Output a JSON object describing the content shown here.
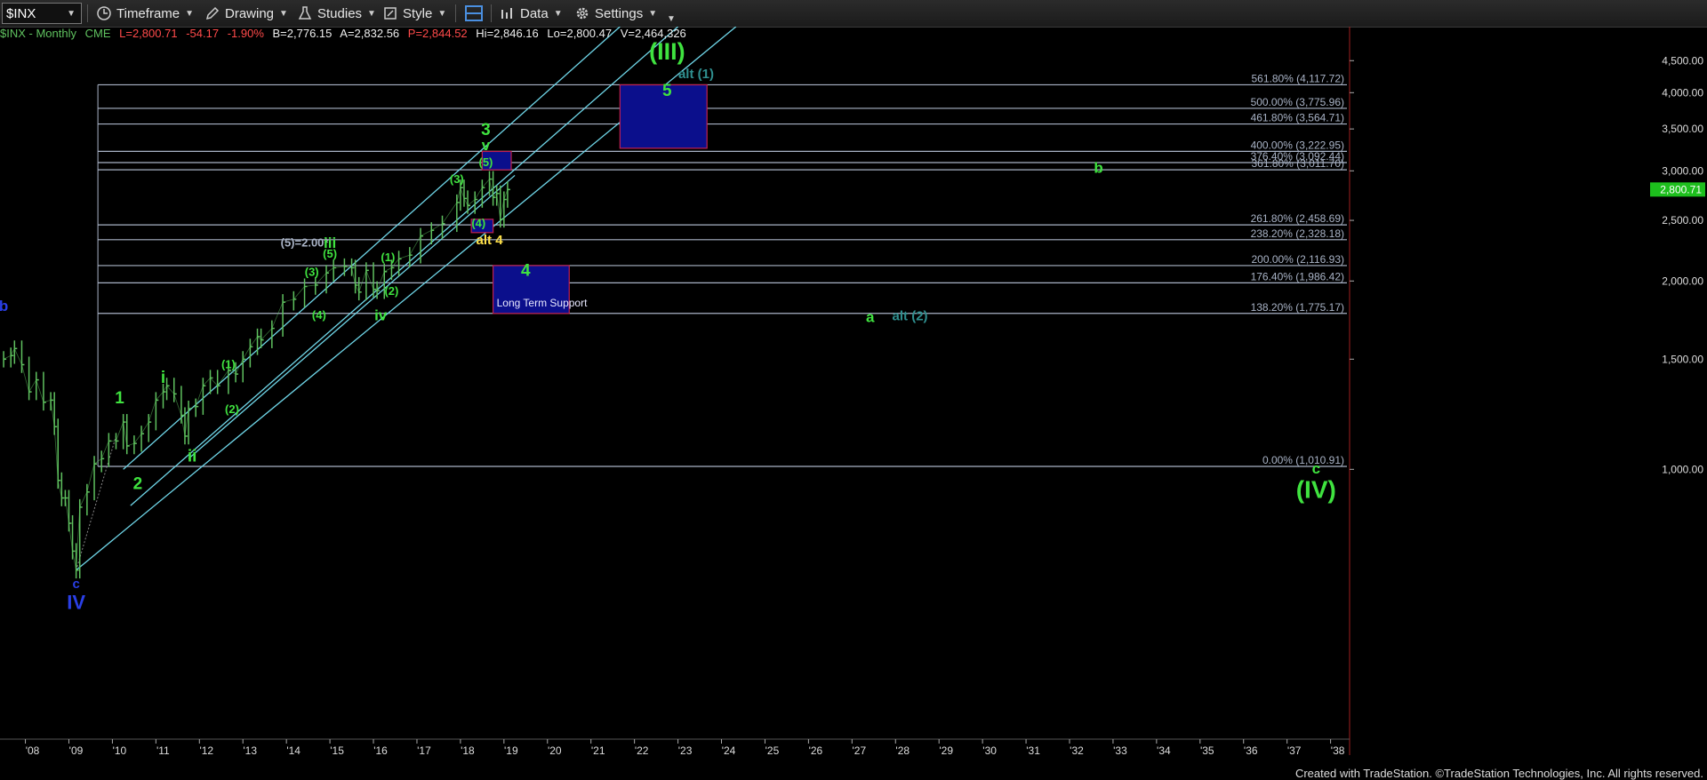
{
  "toolbar": {
    "symbol": "$INX",
    "timeframe": "Timeframe",
    "drawing": "Drawing",
    "studies": "Studies",
    "style": "Style",
    "data": "Data",
    "settings": "Settings"
  },
  "info": {
    "symbol_desc": "$INX - Monthly",
    "exchange": "CME",
    "last": "L=2,800.71",
    "change": "-54.17",
    "change_pct": "-1.90%",
    "bid": "B=2,776.15",
    "ask": "A=2,832.56",
    "prev": "P=2,844.52",
    "hi": "Hi=2,846.16",
    "lo": "Lo=2,800.47",
    "volume": "V=2,464,326"
  },
  "footer": "Created with TradeStation. ©TradeStation Technologies, Inc. All rights reserved.",
  "colors": {
    "background": "#000000",
    "price_bars": "#5fc15f",
    "channel": "#6fd6e8",
    "fib_line": "#a9b3c6",
    "green_label": "#3fe23f",
    "blue_label": "#2a3fe6",
    "yellow_label": "#ffe14a",
    "box_fill": "#0b0f8c",
    "last_price_badge": "#1dbf1d"
  },
  "chart_data": {
    "type": "line",
    "title": "",
    "xlabel": "",
    "ylabel": "",
    "y_scale": "log",
    "ylim": [
      617,
      5100
    ],
    "xlim": [
      "2007-06",
      "2038-06"
    ],
    "x_ticks": [
      "'08",
      "'09",
      "'10",
      "'11",
      "'12",
      "'13",
      "'14",
      "'15",
      "'16",
      "'17",
      "'18",
      "'19",
      "'20",
      "'21",
      "'22",
      "'23",
      "'24",
      "'25",
      "'26",
      "'27",
      "'28",
      "'29",
      "'30",
      "'31",
      "'32",
      "'33",
      "'34",
      "'35",
      "'36",
      "'37",
      "'38"
    ],
    "y_ticks": [
      "1,000.00",
      "1,500.00",
      "2,000.00",
      "2,500.00",
      "3,000.00",
      "3,500.00",
      "4,000.00",
      "4,500.00"
    ],
    "y_tick_values": [
      1000,
      1500,
      2000,
      2500,
      3000,
      3500,
      4000,
      4500
    ],
    "last_price_label": "2,800.71",
    "last_price": 2800.71,
    "series": [
      {
        "x": [
          "2007-07",
          "2007-09",
          "2007-10",
          "2007-12",
          "2008-02",
          "2008-04",
          "2008-06",
          "2008-08",
          "2008-09",
          "2008-10",
          "2008-11",
          "2008-12",
          "2009-01",
          "2009-02",
          "2009-03",
          "2009-04",
          "2009-06",
          "2009-08",
          "2009-10",
          "2009-12",
          "2010-02",
          "2010-04",
          "2010-05",
          "2010-07",
          "2010-09",
          "2010-11",
          "2011-01",
          "2011-03",
          "2011-04",
          "2011-06",
          "2011-08",
          "2011-09",
          "2011-10",
          "2011-12",
          "2012-02",
          "2012-04",
          "2012-06",
          "2012-09",
          "2012-11",
          "2013-01",
          "2013-03",
          "2013-05",
          "2013-06",
          "2013-09",
          "2013-12",
          "2014-03",
          "2014-06",
          "2014-09",
          "2014-12",
          "2015-02",
          "2015-05",
          "2015-07",
          "2015-08",
          "2015-09",
          "2015-11",
          "2016-01",
          "2016-02",
          "2016-04",
          "2016-06",
          "2016-08",
          "2016-11",
          "2017-02",
          "2017-05",
          "2017-08",
          "2017-12",
          "2018-01",
          "2018-02",
          "2018-03",
          "2018-05",
          "2018-07",
          "2018-09",
          "2018-10",
          "2018-11",
          "2018-12",
          "2019-01",
          "2019-02"
        ],
        "values": [
          1500,
          1520,
          1560,
          1470,
          1330,
          1390,
          1280,
          1290,
          1170,
          960,
          900,
          900,
          820,
          740,
          690,
          870,
          920,
          1020,
          1040,
          1110,
          1110,
          1190,
          1090,
          1100,
          1140,
          1190,
          1290,
          1330,
          1360,
          1320,
          1220,
          1130,
          1250,
          1260,
          1360,
          1400,
          1360,
          1440,
          1420,
          1500,
          1570,
          1630,
          1610,
          1680,
          1850,
          1870,
          1960,
          1970,
          2060,
          2100,
          2110,
          2100,
          1970,
          1920,
          2080,
          1940,
          1930,
          2070,
          2100,
          2170,
          2200,
          2360,
          2410,
          2470,
          2670,
          2820,
          2710,
          2640,
          2700,
          2820,
          2910,
          2720,
          2760,
          2510,
          2700,
          2800.71
        ]
      }
    ],
    "fib_levels": [
      {
        "label": "561.80% (4,117.72)",
        "value": 4117.72
      },
      {
        "label": "500.00% (3,775.96)",
        "value": 3775.96
      },
      {
        "label": "461.80% (3,564.71)",
        "value": 3564.71
      },
      {
        "label": "400.00% (3,222.95)",
        "value": 3222.95
      },
      {
        "label": "376.40% (3,092.44)",
        "value": 3092.44
      },
      {
        "label": "361.80% (3,011.70)",
        "value": 3011.7
      },
      {
        "label": "261.80% (2,458.69)",
        "value": 2458.69
      },
      {
        "label": "238.20% (2,328.18)",
        "value": 2328.18
      },
      {
        "label": "200.00% (2,116.93)",
        "value": 2116.93
      },
      {
        "label": "176.40% (1,986.42)",
        "value": 1986.42
      },
      {
        "label": "138.20% (1,775.17)",
        "value": 1775.17
      },
      {
        "label": "0.00% (1,010.91)",
        "value": 1010.91
      }
    ],
    "boxes": [
      {
        "label": "Long Term Support",
        "x": [
          "2018-10",
          "2020-07"
        ],
        "y": [
          1775,
          2117
        ]
      },
      {
        "label": "",
        "x": [
          "2021-09",
          "2023-09"
        ],
        "y": [
          3260,
          4117
        ]
      },
      {
        "label": "",
        "x": [
          "2018-07",
          "2019-03"
        ],
        "y": [
          3011,
          3222
        ]
      },
      {
        "label": "",
        "x": [
          "2018-04",
          "2018-10"
        ],
        "y": [
          2390,
          2510
        ]
      }
    ],
    "channels": [
      {
        "x": [
          "2010-04",
          "2021-09"
        ],
        "y": [
          1000,
          5100
        ]
      },
      {
        "x": [
          "2010-06",
          "2023-01"
        ],
        "y": [
          875,
          5100
        ]
      },
      {
        "x": [
          "2009-03",
          "2024-05"
        ],
        "y": [
          690,
          5100
        ]
      },
      {
        "x": [
          "2011-10",
          "2019-04"
        ],
        "y": [
          1040,
          2950
        ]
      }
    ],
    "annotations": [
      {
        "text": "b",
        "x": "2007-07",
        "y": 1790,
        "color": "blue",
        "size": 17
      },
      {
        "text": "c",
        "x": "2009-03",
        "y": 646,
        "color": "blue",
        "size": 15
      },
      {
        "text": "IV",
        "x": "2009-03",
        "y": 598,
        "color": "blue",
        "size": 22
      },
      {
        "text": "1",
        "x": "2010-03",
        "y": 1275,
        "color": "green",
        "size": 19
      },
      {
        "text": "2",
        "x": "2010-08",
        "y": 930,
        "color": "green",
        "size": 19
      },
      {
        "text": "i",
        "x": "2011-03",
        "y": 1375,
        "color": "green",
        "size": 19
      },
      {
        "text": "ii",
        "x": "2011-11",
        "y": 1030,
        "color": "green",
        "size": 19
      },
      {
        "text": "(1)",
        "x": "2012-09",
        "y": 1450,
        "color": "green",
        "size": 13
      },
      {
        "text": "(2)",
        "x": "2012-10",
        "y": 1230,
        "color": "green",
        "size": 13
      },
      {
        "text": "(5)=2.00*",
        "x": "2014-06",
        "y": 2270,
        "color": "fib",
        "size": 13
      },
      {
        "text": "iii",
        "x": "2015-01",
        "y": 2260,
        "color": "green",
        "size": 17
      },
      {
        "text": "(5)",
        "x": "2015-01",
        "y": 2180,
        "color": "green",
        "size": 13
      },
      {
        "text": "(3)",
        "x": "2014-08",
        "y": 2040,
        "color": "green",
        "size": 13
      },
      {
        "text": "(4)",
        "x": "2014-10",
        "y": 1740,
        "color": "green",
        "size": 13
      },
      {
        "text": "(1)",
        "x": "2016-05",
        "y": 2150,
        "color": "green",
        "size": 13
      },
      {
        "text": "(2)",
        "x": "2016-06",
        "y": 1900,
        "color": "green",
        "size": 13
      },
      {
        "text": "iv",
        "x": "2016-03",
        "y": 1730,
        "color": "green",
        "size": 17
      },
      {
        "text": "(3)",
        "x": "2017-12",
        "y": 2870,
        "color": "green",
        "size": 13
      },
      {
        "text": "(4)",
        "x": "2018-06",
        "y": 2440,
        "color": "green",
        "size": 13
      },
      {
        "text": "(5)",
        "x": "2018-08",
        "y": 3050,
        "color": "green",
        "size": 13
      },
      {
        "text": "3",
        "x": "2018-08",
        "y": 3420,
        "color": "green",
        "size": 19
      },
      {
        "text": "v",
        "x": "2018-08",
        "y": 3240,
        "color": "green",
        "size": 17
      },
      {
        "text": "alt 4",
        "x": "2018-09",
        "y": 2290,
        "color": "yellow",
        "size": 15
      },
      {
        "text": "4",
        "x": "2019-07",
        "y": 2040,
        "color": "green",
        "size": 19
      },
      {
        "text": "(III)",
        "x": "2022-10",
        "y": 4520,
        "color": "green",
        "size": 27
      },
      {
        "text": "5",
        "x": "2022-10",
        "y": 3950,
        "color": "green",
        "size": 19
      },
      {
        "text": "alt (1)",
        "x": "2023-06",
        "y": 4220,
        "color": "teal",
        "size": 15
      },
      {
        "text": "b",
        "x": "2032-09",
        "y": 2980,
        "color": "green",
        "size": 17
      },
      {
        "text": "a",
        "x": "2027-06",
        "y": 1720,
        "color": "green",
        "size": 17
      },
      {
        "text": "alt (2)",
        "x": "2028-05",
        "y": 1730,
        "color": "teal",
        "size": 15
      },
      {
        "text": "c",
        "x": "2037-09",
        "y": 985,
        "color": "green",
        "size": 17
      },
      {
        "text": "(IV)",
        "x": "2037-09",
        "y": 900,
        "color": "green",
        "size": 28
      }
    ]
  }
}
